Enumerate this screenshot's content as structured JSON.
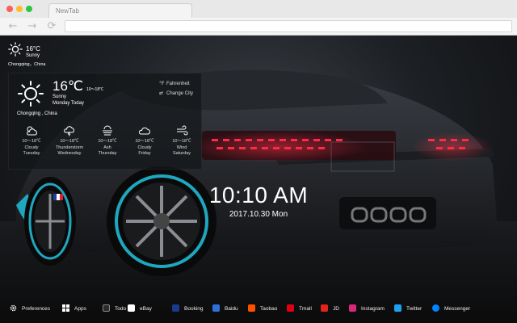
{
  "browser": {
    "tab_title": "NewTab",
    "nav": {
      "back": "←",
      "forward": "→",
      "reload": "⟳"
    }
  },
  "weather_small": {
    "temp": "16°C",
    "condition": "Sunny",
    "city": "Chongqing，China"
  },
  "weather_panel": {
    "temp": "16℃",
    "range": "10～18℃",
    "condition": "Sunny",
    "day": "Monday Today",
    "city": "Chongqing , China",
    "option_units": "Fahrenheit",
    "option_city": "Change City",
    "option_units_icon": "°F",
    "option_city_icon": "⇄",
    "forecast": [
      {
        "icon": "cloudy-sun-icon",
        "range": "10～18℃",
        "condition": "Cloudy",
        "day": "Tuesday"
      },
      {
        "icon": "thunderstorm-icon",
        "range": "10～18℃",
        "condition": "Thunderstorm",
        "day": "Wednesday"
      },
      {
        "icon": "ash-icon",
        "range": "10～18℃",
        "condition": "Ash",
        "day": "Thursday"
      },
      {
        "icon": "cloud-icon",
        "range": "10～18℃",
        "condition": "Cloudy",
        "day": "Friday"
      },
      {
        "icon": "wind-icon",
        "range": "10～18℃",
        "condition": "Wind",
        "day": "Saturday"
      }
    ]
  },
  "clock": {
    "time": "10:10 AM",
    "date": "2017.10.30 Mon"
  },
  "bottom_bar": {
    "preferences": "Preferences",
    "apps": "Apps",
    "links": [
      {
        "label": "Todo",
        "icon": "todo-icon",
        "color": "#2b2b2b"
      },
      {
        "label": "eBay",
        "icon": "ebay-icon",
        "color": "#ffffff"
      },
      {
        "label": "Booking",
        "icon": "booking-icon",
        "color": "#1a3a8c"
      },
      {
        "label": "Baidu",
        "icon": "baidu-icon",
        "color": "#2e6fdc"
      },
      {
        "label": "Taobao",
        "icon": "taobao-icon",
        "color": "#ff5000"
      },
      {
        "label": "Tmall",
        "icon": "tmall-icon",
        "color": "#e00014"
      },
      {
        "label": "JD",
        "icon": "jd-icon",
        "color": "#e1251b"
      },
      {
        "label": "Instagram",
        "icon": "instagram-icon",
        "color": "#d62976"
      },
      {
        "label": "Twitter",
        "icon": "twitter-icon",
        "color": "#1da1f2"
      },
      {
        "label": "Messenger",
        "icon": "messenger-icon",
        "color": "#0084ff"
      }
    ]
  },
  "colors": {
    "taillight": "#e0203a",
    "accent_teal": "#1fa7c0"
  }
}
